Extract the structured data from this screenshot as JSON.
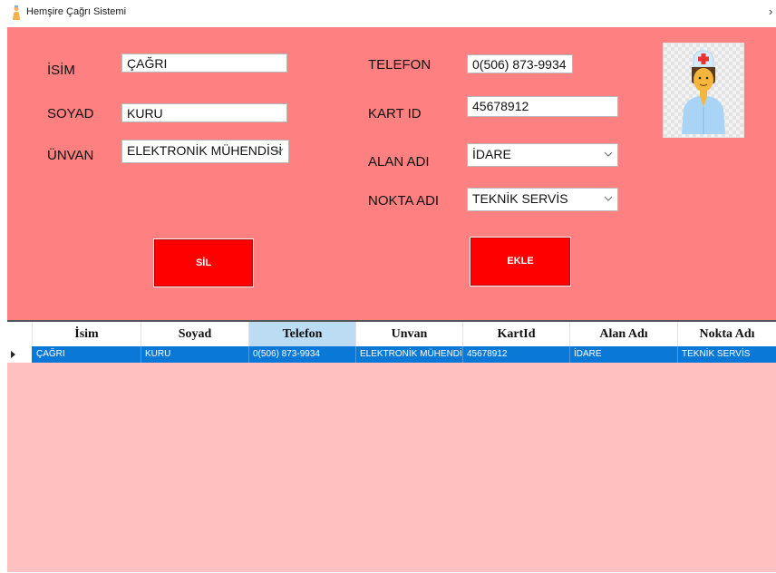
{
  "window": {
    "title": "Hemşire Çağrı Sistemi",
    "close_glyph": "›"
  },
  "form": {
    "isim_label": "İSİM",
    "isim_value": "ÇAĞRI",
    "soyad_label": "SOYAD",
    "soyad_value": "KURU",
    "unvan_label": "ÜNVAN",
    "unvan_value": "ELEKTRONİK MÜHENDİSİ",
    "telefon_label": "TELEFON",
    "telefon_value": "0(506) 873-9934",
    "kart_label": "KART ID",
    "kart_value": "45678912",
    "alan_label": "ALAN ADI",
    "alan_value": "İDARE",
    "nokta_label": "NOKTA ADI",
    "nokta_value": "TEKNİK SERVİS",
    "sil_button": "SİL",
    "ekle_button": "EKLE",
    "avatar_icon": "nurse-icon"
  },
  "grid": {
    "columns": [
      "İsim",
      "Soyad",
      "Telefon",
      "Unvan",
      "KartId",
      "Alan Adı",
      "Nokta Adı"
    ],
    "selected_column": "Telefon",
    "rows": [
      [
        "ÇAĞRI",
        "KURU",
        "0(506) 873-9934",
        "ELEKTRONİK MÜHENDİSİ",
        "45678912",
        "İDARE",
        "TEKNİK SERVİS"
      ]
    ]
  },
  "colors": {
    "form_background": "#ff8080",
    "grid_background": "#ffc0c0",
    "button_red": "#ff0000",
    "row_selected": "#0a78d7",
    "header_selected": "#bcdcf4"
  }
}
